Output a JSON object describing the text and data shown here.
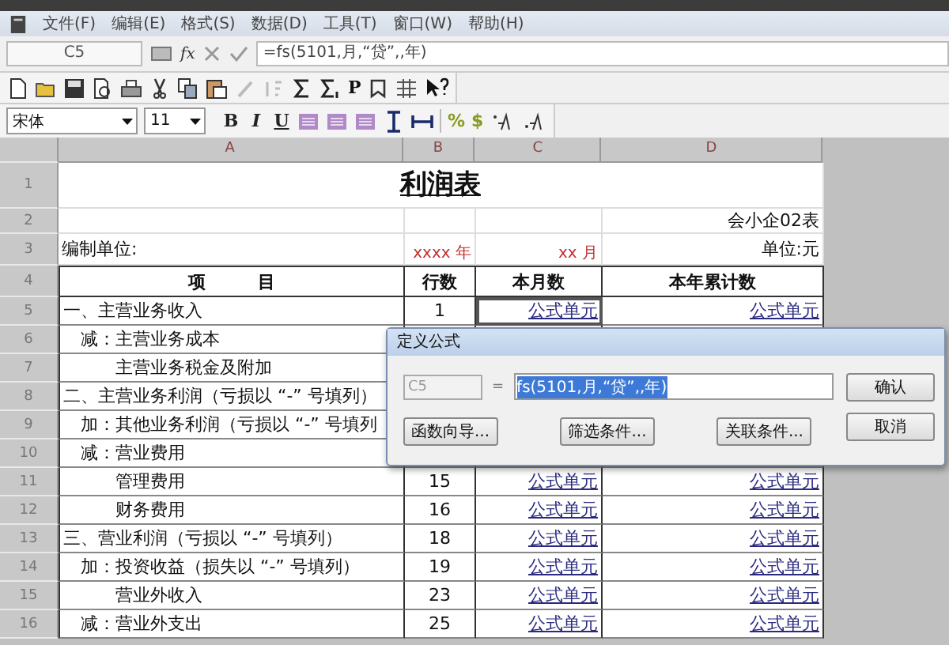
{
  "menu": [
    "文件(F)",
    "编辑(E)",
    "格式(S)",
    "数据(D)",
    "工具(T)",
    "窗口(W)",
    "帮助(H)"
  ],
  "formula_bar": {
    "cell_ref": "C5",
    "function_label": "fx",
    "formula": "=fs(5101,月,“贷”,,年)"
  },
  "toolbar": {
    "p_button": "P"
  },
  "format_bar": {
    "font": "宋体",
    "size": "11",
    "style_buttons": [
      "B",
      "I",
      "U"
    ],
    "number_buttons": [
      "%",
      "$"
    ]
  },
  "sheet": {
    "columns": [
      "A",
      "B",
      "C",
      "D"
    ],
    "rows": [
      {
        "num": "1",
        "kind": "title",
        "title": "利润表"
      },
      {
        "num": "2",
        "kind": "info",
        "d": "会小企02表"
      },
      {
        "num": "3",
        "kind": "period",
        "a": "编制单位:",
        "b": "xxxx 年",
        "c": "xx 月",
        "d": "单位:元"
      },
      {
        "num": "4",
        "kind": "header",
        "a": "项　　　目",
        "b": "行数",
        "c": "本月数",
        "d": "本年累计数"
      },
      {
        "num": "5",
        "kind": "item",
        "selected": true,
        "a": "一、主营业务收入",
        "b": "1",
        "c": "公式单元",
        "d": "公式单元"
      },
      {
        "num": "6",
        "kind": "item",
        "a": "　减：主营业务成本"
      },
      {
        "num": "7",
        "kind": "item",
        "a": "　　　主营业务税金及附加"
      },
      {
        "num": "8",
        "kind": "item",
        "a": "二、主营业务利润（亏损以 “-” 号填列）"
      },
      {
        "num": "9",
        "kind": "item",
        "a": "　加：其他业务利润（亏损以 “-” 号填列"
      },
      {
        "num": "10",
        "kind": "item",
        "a": "　减：营业费用"
      },
      {
        "num": "11",
        "kind": "item",
        "selected": false,
        "a": "　　　管理费用",
        "b": "15",
        "c": "公式单元",
        "d": "公式单元"
      },
      {
        "num": "12",
        "kind": "item",
        "selected": false,
        "a": "　　　财务费用",
        "b": "16",
        "c": "公式单元",
        "d": "公式单元"
      },
      {
        "num": "13",
        "kind": "item",
        "selected": false,
        "a": "三、营业利润（亏损以 “-” 号填列）",
        "b": "18",
        "c": "公式单元",
        "d": "公式单元"
      },
      {
        "num": "14",
        "kind": "item",
        "selected": false,
        "a": "　加：投资收益（损失以 “-” 号填列）",
        "b": "19",
        "c": "公式单元",
        "d": "公式单元"
      },
      {
        "num": "15",
        "kind": "item",
        "selected": false,
        "a": "　　　营业外收入",
        "b": "23",
        "c": "公式单元",
        "d": "公式单元"
      },
      {
        "num": "16",
        "kind": "item",
        "selected": false,
        "a": "　减：营业外支出",
        "b": "25",
        "c": "公式单元",
        "d": "公式单元"
      }
    ]
  },
  "dialog": {
    "title": "定义公式",
    "cell_ref": "C5",
    "equals": "=",
    "formula": "fs(5101,月,“贷”,,年)",
    "formula_selected": true,
    "side_buttons": [
      "确认",
      "取消"
    ],
    "bottom_buttons": [
      "函数向导...",
      "筛选条件...",
      "关联条件..."
    ]
  }
}
